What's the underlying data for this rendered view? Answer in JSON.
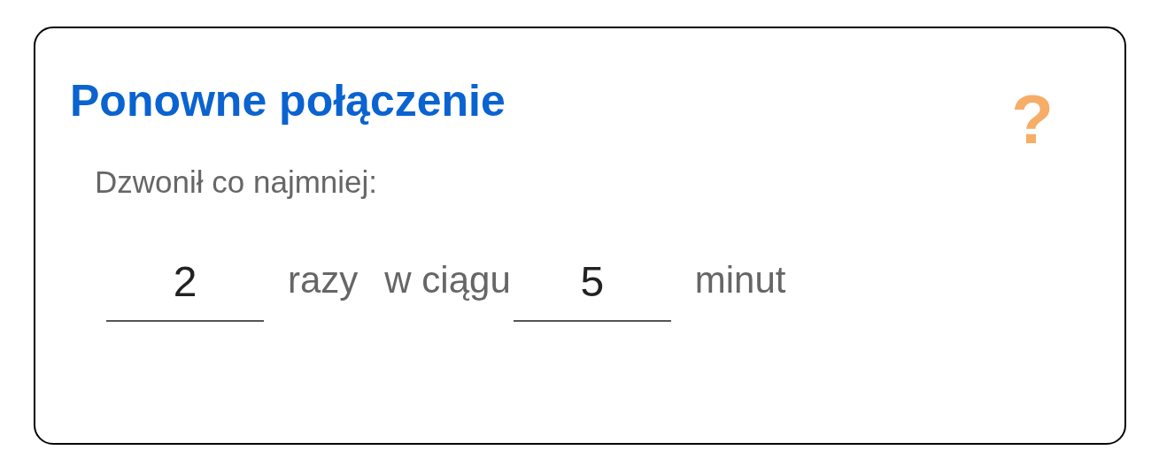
{
  "card": {
    "title": "Ponowne połączenie",
    "help": "?",
    "label": "Dzwonił co najmniej:",
    "row": [
      {
        "kind": "field",
        "value": "2"
      },
      {
        "kind": "text",
        "text": "razy"
      },
      {
        "kind": "text",
        "text": "w ciągu"
      },
      {
        "kind": "field",
        "value": "5"
      },
      {
        "kind": "text",
        "text": "minut"
      }
    ]
  }
}
